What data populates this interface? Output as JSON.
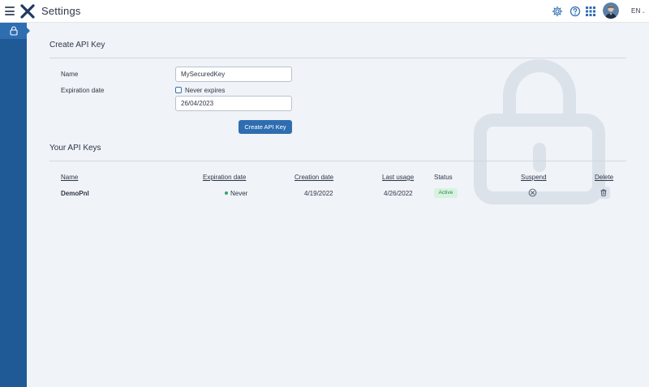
{
  "header": {
    "title": "Settings",
    "language": "EN",
    "icons": [
      "menu-icon",
      "logo-icon",
      "gear-icon",
      "help-icon",
      "apps-grid-icon",
      "avatar"
    ]
  },
  "sidebar": {
    "items": [
      {
        "icon": "lock-icon",
        "active": true
      }
    ]
  },
  "create_form": {
    "title": "Create API Key",
    "name_label": "Name",
    "name_value": "MySecuredKey",
    "expiration_label": "Expiration date",
    "never_expires_label": "Never expires",
    "never_expires_checked": false,
    "expiration_value": "26/04/2023",
    "submit_label": "Create API Key"
  },
  "keys_table": {
    "title": "Your API Keys",
    "columns": {
      "name": "Name",
      "expiration": "Expiration date",
      "creation": "Creation date",
      "last_usage": "Last usage",
      "status": "Status",
      "suspend": "Suspend",
      "delete": "Delete"
    },
    "rows": [
      {
        "name": "DemoPnl",
        "expiration": "Never",
        "creation": "4/19/2022",
        "last_usage": "4/26/2022",
        "status": "Active"
      }
    ]
  },
  "colors": {
    "brand": "#2f6db1",
    "sidebar": "#1f5996",
    "active_badge_bg": "#d7f3df",
    "active_badge_text": "#2f855a"
  }
}
